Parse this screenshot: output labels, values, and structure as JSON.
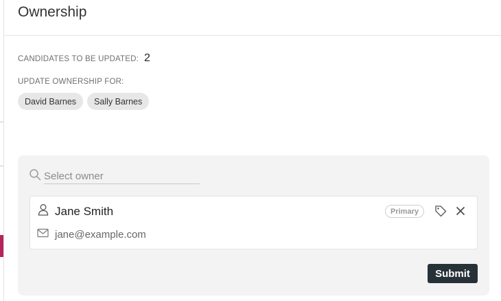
{
  "modal": {
    "title": "Ownership",
    "candidates_label": "CANDIDATES TO BE UPDATED:",
    "candidates_count": "2",
    "update_label": "UPDATE OWNERSHIP FOR:",
    "chips": [
      "David Barnes",
      "Sally Barnes"
    ]
  },
  "owner_panel": {
    "search": {
      "placeholder": "Select owner",
      "value": "",
      "icon": "search-icon"
    },
    "owner": {
      "name": "Jane Smith",
      "email": "jane@example.com",
      "badge": "Primary",
      "icons": [
        "user-icon",
        "mail-icon",
        "tag-icon",
        "close-icon"
      ]
    },
    "submit_label": "Submit"
  },
  "colors": {
    "submit_bg": "#263238",
    "panel_bg": "#f3f3f3",
    "chip_bg": "#e7e7e7",
    "backdrop_accent": "#b5245a"
  }
}
